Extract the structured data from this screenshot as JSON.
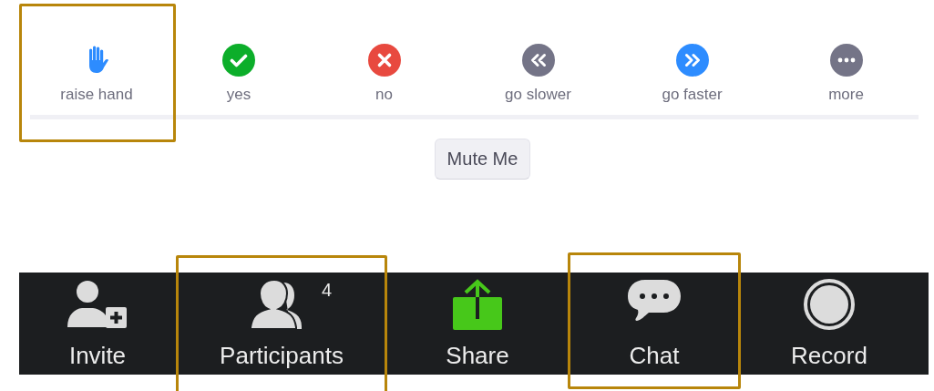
{
  "reactions": [
    {
      "kind": "hand",
      "label": "raise hand",
      "highlighted": true
    },
    {
      "kind": "yes",
      "label": "yes",
      "highlighted": false
    },
    {
      "kind": "no",
      "label": "no",
      "highlighted": false
    },
    {
      "kind": "slower",
      "label": "go slower",
      "highlighted": false
    },
    {
      "kind": "faster",
      "label": "go faster",
      "highlighted": false
    },
    {
      "kind": "more",
      "label": "more",
      "highlighted": false
    }
  ],
  "mute_button": "Mute Me",
  "toolbar": [
    {
      "kind": "invite",
      "label": "Invite",
      "highlighted": false
    },
    {
      "kind": "participants",
      "label": "Participants",
      "count": "4",
      "highlighted": true
    },
    {
      "kind": "share",
      "label": "Share",
      "highlighted": false
    },
    {
      "kind": "chat",
      "label": "Chat",
      "highlighted": true
    },
    {
      "kind": "record",
      "label": "Record",
      "highlighted": false
    }
  ]
}
